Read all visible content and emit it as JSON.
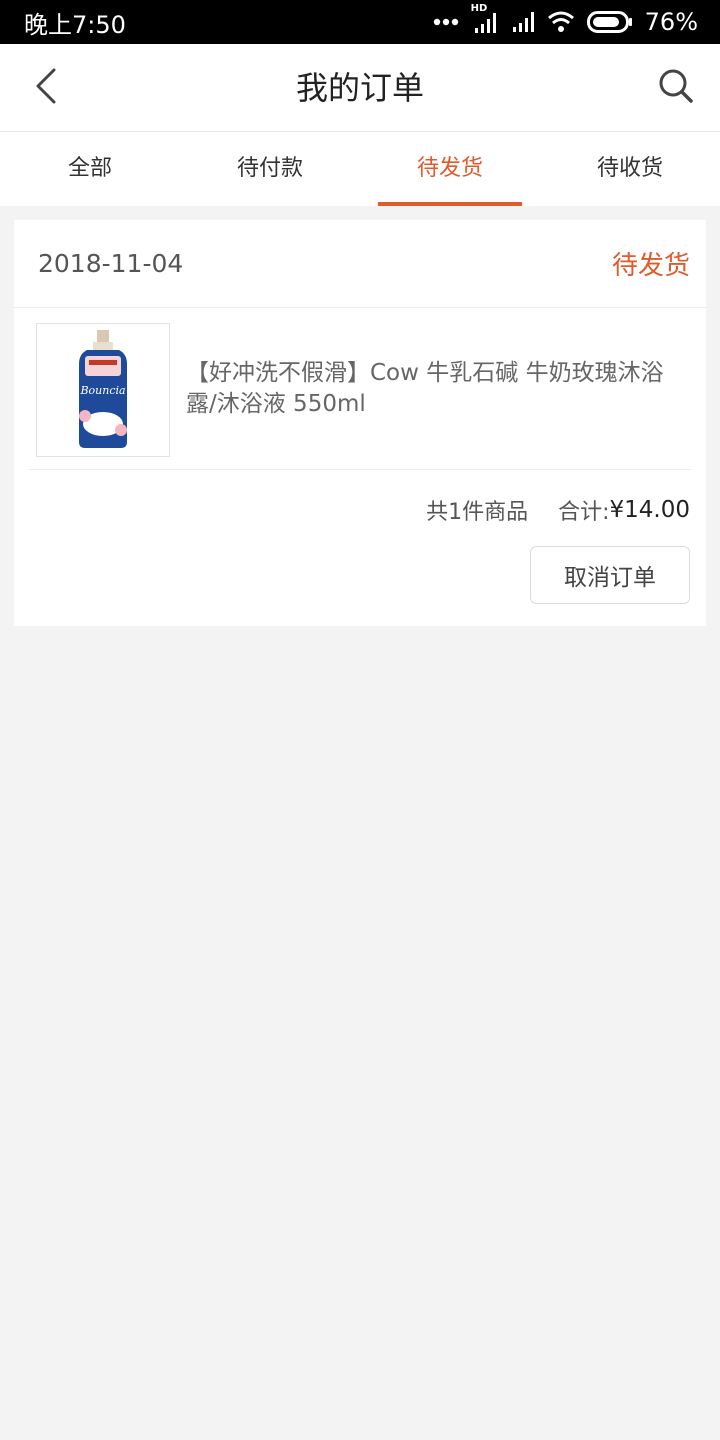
{
  "status_bar": {
    "time": "晚上7:50",
    "network_label": "HD",
    "battery_percent": "76%",
    "battery_level": 0.76,
    "icons": [
      "more-dots-icon",
      "signal-hd-icon",
      "signal-icon",
      "wifi-icon",
      "battery-icon"
    ]
  },
  "header": {
    "title": "我的订单",
    "back_icon": "chevron-left-icon",
    "search_icon": "search-icon"
  },
  "tabs": [
    {
      "label": "全部",
      "active": false
    },
    {
      "label": "待付款",
      "active": false
    },
    {
      "label": "待发货",
      "active": true
    },
    {
      "label": "待收货",
      "active": false
    }
  ],
  "order": {
    "date": "2018-11-04",
    "status": "待发货",
    "product": {
      "name": "【好冲洗不假滑】Cow 牛乳石碱 牛奶玫瑰沐浴露/沐浴液 550ml",
      "image_text": "Bouncia"
    },
    "item_count_text": "共1件商品",
    "total_label": "合计:",
    "total_amount": "¥14.00",
    "cancel_button": "取消订单"
  },
  "colors": {
    "accent": "#e05a2b",
    "background": "#f3f3f3"
  }
}
